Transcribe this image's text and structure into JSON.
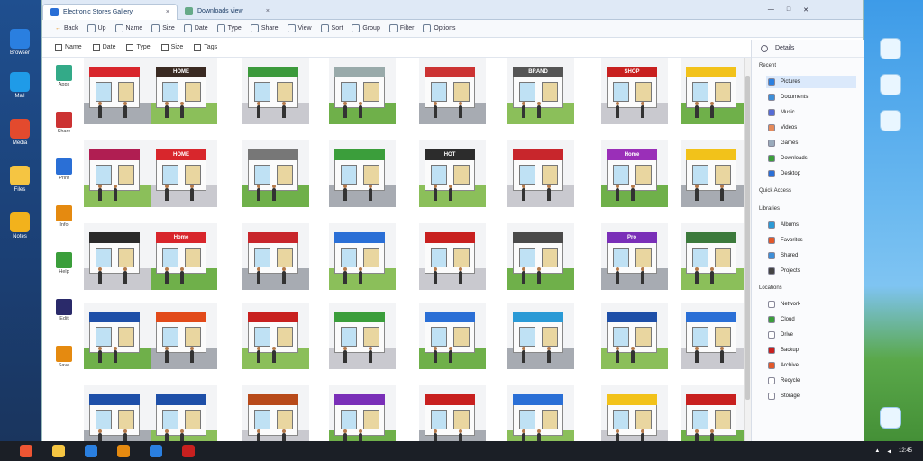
{
  "desktop_left": {
    "icons": [
      {
        "name": "edge-icon",
        "label": "Browser",
        "color": "#2a7fe0"
      },
      {
        "name": "mail-icon",
        "label": "Mail",
        "color": "#1f9be8"
      },
      {
        "name": "media-icon",
        "label": "Media",
        "color": "#e34a2e"
      },
      {
        "name": "folder-icon",
        "label": "Files",
        "color": "#f5c542"
      },
      {
        "name": "note-icon",
        "label": "Notes",
        "color": "#f2b21c"
      }
    ]
  },
  "window": {
    "tabs": [
      {
        "label": "Electronic Stores Gallery",
        "close": "×"
      },
      {
        "label": "Downloads view",
        "close": "×"
      }
    ],
    "controls": {
      "min": "—",
      "max": "□",
      "close": "✕"
    },
    "toolbar": [
      "Back",
      "Up",
      "Name",
      "Size",
      "Date",
      "Type",
      "Share",
      "View",
      "Sort",
      "Group",
      "Filter",
      "Options"
    ],
    "subbar": [
      "Name",
      "Date",
      "Type",
      "Size",
      "Tags"
    ]
  },
  "left_panel": {
    "items": [
      "Apps",
      "Share",
      "Print",
      "Info",
      "Help",
      "Edit",
      "Save"
    ]
  },
  "grid": {
    "rows": [
      [
        {
          "sign": "",
          "color": "#d8262c"
        },
        {
          "sign": "HOME",
          "color": "#3a2a22"
        },
        {
          "sign": "",
          "color": "#3c9a3c"
        },
        {
          "sign": "",
          "color": "#9aa"
        },
        {
          "sign": "",
          "color": "#c33"
        },
        {
          "sign": "BRAND",
          "color": "#555"
        },
        {
          "sign": "SHOP",
          "color": "#c8201f"
        },
        {
          "sign": "",
          "color": "#f2c21a"
        }
      ],
      [
        {
          "sign": "",
          "color": "#b01e52"
        },
        {
          "sign": "HOME",
          "color": "#d8262c"
        },
        {
          "sign": "",
          "color": "#777"
        },
        {
          "sign": "",
          "color": "#3b9e3b"
        },
        {
          "sign": "HOT",
          "color": "#2c2c2c"
        },
        {
          "sign": "",
          "color": "#c8262c"
        },
        {
          "sign": "Home",
          "color": "#9a2fb8"
        },
        {
          "sign": "",
          "color": "#f2c21a"
        }
      ],
      [
        {
          "sign": "",
          "color": "#2a2a2a"
        },
        {
          "sign": "Home",
          "color": "#d8262c"
        },
        {
          "sign": "",
          "color": "#c8262c"
        },
        {
          "sign": "",
          "color": "#2a6fd6"
        },
        {
          "sign": "",
          "color": "#c8201f"
        },
        {
          "sign": "",
          "color": "#4a4a4a"
        },
        {
          "sign": "Pro",
          "color": "#7a2fb8"
        },
        {
          "sign": "",
          "color": "#3c7a3c"
        }
      ],
      [
        {
          "sign": "",
          "color": "#1e4fa8"
        },
        {
          "sign": "",
          "color": "#e24a1a"
        },
        {
          "sign": "",
          "color": "#c8201f"
        },
        {
          "sign": "",
          "color": "#3b9e3b"
        },
        {
          "sign": "",
          "color": "#2a6fd6"
        },
        {
          "sign": "",
          "color": "#2a9ad6"
        },
        {
          "sign": "",
          "color": "#1e4fa8"
        },
        {
          "sign": "",
          "color": "#2a6fd6"
        }
      ],
      [
        {
          "sign": "",
          "color": "#1e4fa8"
        },
        {
          "sign": "",
          "color": "#1e4fa8"
        },
        {
          "sign": "",
          "color": "#b84a1a"
        },
        {
          "sign": "",
          "color": "#7a2fb8"
        },
        {
          "sign": "",
          "color": "#c8201f"
        },
        {
          "sign": "",
          "color": "#2a6fd6"
        },
        {
          "sign": "",
          "color": "#f2c21a"
        },
        {
          "sign": "",
          "color": "#c8201f"
        }
      ]
    ]
  },
  "right_panel": {
    "header": {
      "label": "Details"
    },
    "sections": [
      {
        "title": "Recent",
        "items": [
          {
            "label": "Pictures",
            "color": "#2a7fe0",
            "selected": true
          },
          {
            "label": "Documents",
            "color": "#3d8fd8"
          },
          {
            "label": "Music",
            "color": "#556cd6"
          },
          {
            "label": "Videos",
            "color": "#e58a5a"
          },
          {
            "label": "Games",
            "color": "#9ab"
          },
          {
            "label": "Downloads",
            "color": "#3b9e3b"
          },
          {
            "label": "Desktop",
            "color": "#2a6fd6"
          }
        ]
      },
      {
        "title": "Quick Access",
        "items": []
      },
      {
        "title": "Libraries",
        "items": [
          {
            "label": "Albums",
            "color": "#2a9ad6"
          },
          {
            "label": "Favorites",
            "color": "#e2582a"
          },
          {
            "label": "Shared",
            "color": "#3d8fd8"
          },
          {
            "label": "Projects",
            "color": "#444"
          }
        ]
      },
      {
        "title": "Locations",
        "items": [
          {
            "label": "Network",
            "color": "#fff"
          },
          {
            "label": "Cloud",
            "color": "#3b9e3b"
          },
          {
            "label": "Drive",
            "color": "#fff"
          },
          {
            "label": "Backup",
            "color": "#c8201f"
          },
          {
            "label": "Archive",
            "color": "#e2582a"
          },
          {
            "label": "Recycle",
            "color": "#fff"
          },
          {
            "label": "Storage",
            "color": "#fff"
          }
        ]
      }
    ]
  },
  "taskbar": {
    "apps": [
      {
        "name": "start-icon",
        "color": "#e53"
      },
      {
        "name": "explorer-icon",
        "color": "#f5c542"
      },
      {
        "name": "browser-icon",
        "color": "#2a7fe0"
      },
      {
        "name": "files-icon",
        "color": "#e58a10"
      },
      {
        "name": "store-icon",
        "color": "#2a7fe0"
      },
      {
        "name": "media-icon",
        "color": "#c8201f"
      }
    ],
    "clock": "12:45"
  }
}
